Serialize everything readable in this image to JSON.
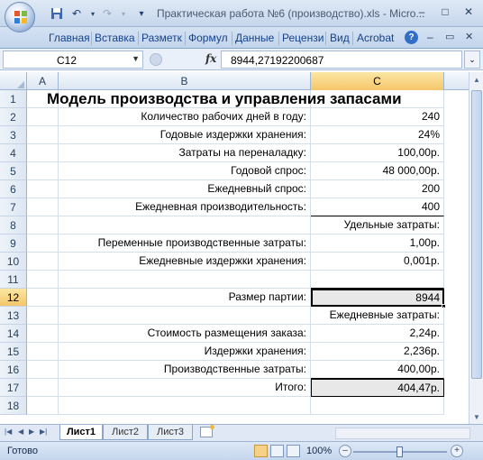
{
  "window": {
    "title": "Практическая работа №6 (производство).xls - Micro...",
    "minimize": "–",
    "maximize": "□",
    "close": "✕"
  },
  "quick_access": {
    "save": "💾",
    "undo": "↶",
    "redo": "↷",
    "customize": "▾"
  },
  "ribbon": {
    "tabs": [
      "Главная",
      "Вставка",
      "Разметк",
      "Формул",
      "Данные",
      "Рецензи",
      "Вид",
      "Acrobat"
    ],
    "help": "?",
    "minimize": "–",
    "restore": "▭",
    "close": "✕"
  },
  "formula_bar": {
    "name_box": "C12",
    "fx": "fx",
    "value": "8944,27192200687"
  },
  "grid": {
    "columns": [
      "A",
      "B",
      "C"
    ],
    "active_column": "C",
    "active_row": "12",
    "title": "Модель производства и управления запасами",
    "rows": [
      {
        "n": "1",
        "b": "",
        "c": ""
      },
      {
        "n": "2",
        "b": "Количество рабочих дней в году:",
        "c": "240"
      },
      {
        "n": "3",
        "b": "Годовые издержки хранения:",
        "c": "24%"
      },
      {
        "n": "4",
        "b": "Затраты на переналадку:",
        "c": "100,00р."
      },
      {
        "n": "5",
        "b": "Годовой спрос:",
        "c": "48 000,00р."
      },
      {
        "n": "6",
        "b": "Ежедневный спрос:",
        "c": "200"
      },
      {
        "n": "7",
        "b": "Ежедневная производительность:",
        "c": "400"
      },
      {
        "n": "8",
        "b": "",
        "c": "Удельные затраты:"
      },
      {
        "n": "9",
        "b": "Переменные производственные затраты:",
        "c": "1,00р."
      },
      {
        "n": "10",
        "b": "Ежедневные издержки хранения:",
        "c": "0,001р."
      },
      {
        "n": "11",
        "b": "",
        "c": ""
      },
      {
        "n": "12",
        "b": "Размер партии:",
        "c": "8944"
      },
      {
        "n": "13",
        "b": "",
        "c": "Ежедневные затраты:"
      },
      {
        "n": "14",
        "b": "Стоимость размещения заказа:",
        "c": "2,24р."
      },
      {
        "n": "15",
        "b": "Издержки хранения:",
        "c": "2,236р."
      },
      {
        "n": "16",
        "b": "Производственные затраты:",
        "c": "400,00р."
      },
      {
        "n": "17",
        "b": "Итого:",
        "c": "404,47р."
      },
      {
        "n": "18",
        "b": "",
        "c": ""
      }
    ]
  },
  "sheets": [
    "Лист1",
    "Лист2",
    "Лист3"
  ],
  "active_sheet": "Лист1",
  "status": {
    "ready": "Готово",
    "zoom": "100%",
    "zoom_out": "–",
    "zoom_in": "+",
    "zoom_level": 0.5
  }
}
